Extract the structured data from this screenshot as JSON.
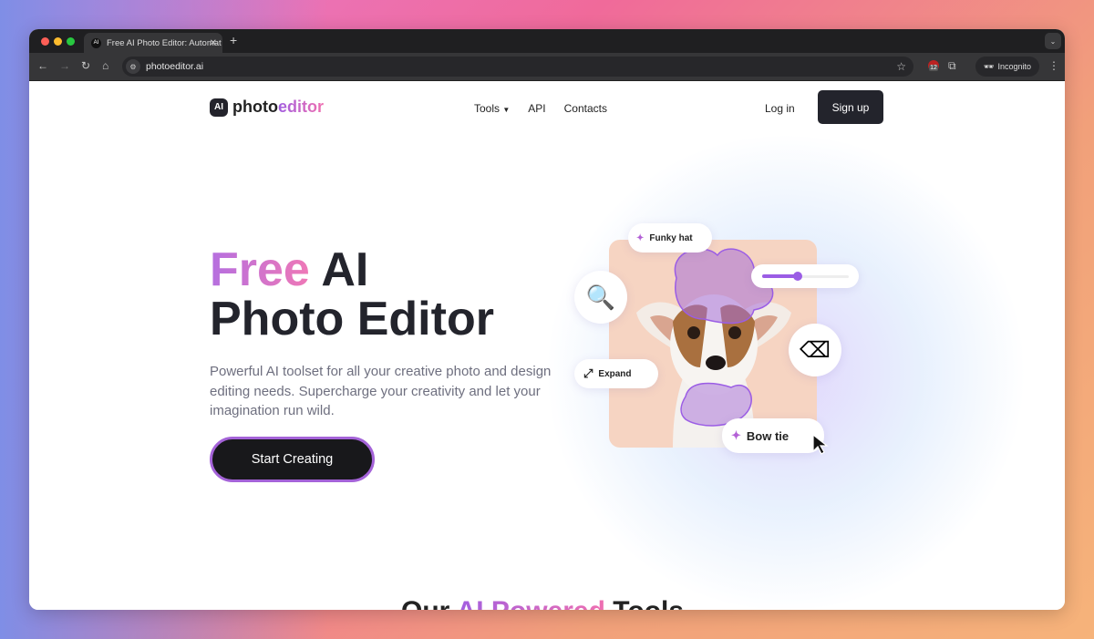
{
  "browser": {
    "tab_title": "Free AI Photo Editor: Automat",
    "tab_favicon": "AI",
    "url": "photoeditor.ai",
    "extension_badge": "12",
    "incognito_label": "Incognito"
  },
  "nav": {
    "logo_mark": "AI",
    "logo_a": "photo",
    "logo_b": "editor",
    "links": [
      "Tools",
      "API",
      "Contacts"
    ],
    "login": "Log in",
    "signup": "Sign up"
  },
  "hero": {
    "title_accent": "Free",
    "title_rest": " AI",
    "title_line2": "Photo Editor",
    "description": "Powerful AI toolset for all your creative photo and design editing needs. Supercharge your creativity and let your imagination run wild.",
    "cta": "Start Creating"
  },
  "illustration": {
    "chip_hat": "Funky hat",
    "chip_expand": "Expand",
    "chip_bow": "Bow tie",
    "slider_value_percent": 42,
    "accent": "#9b5de5"
  },
  "section": {
    "title_a": "Our ",
    "title_b": "AI Powered",
    "title_c": " Tools"
  }
}
